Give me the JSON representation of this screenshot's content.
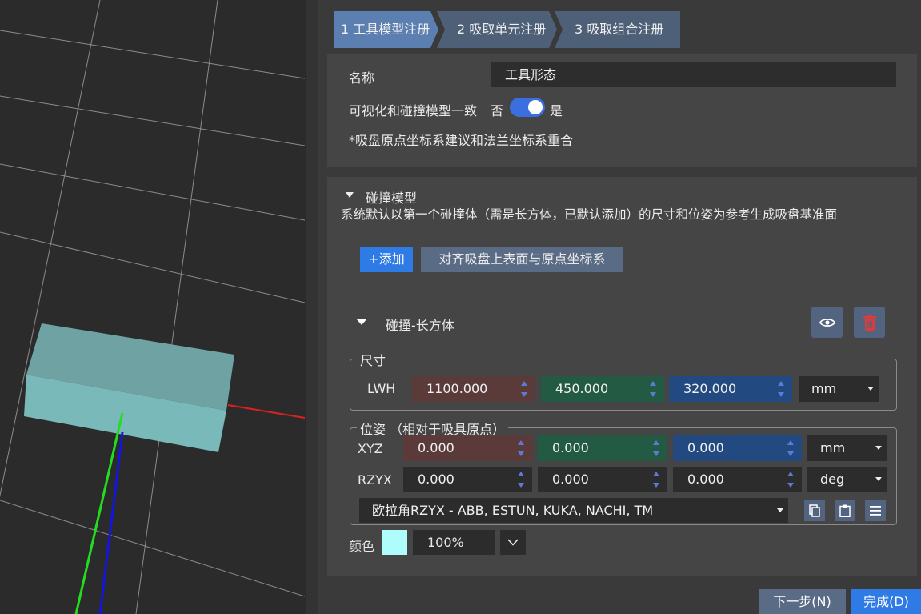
{
  "steps": [
    "1 工具模型注册",
    "2 吸取单元注册",
    "3 吸取组合注册"
  ],
  "basic": {
    "name_label": "名称",
    "name_value": "工具形态",
    "consistency_label": "可视化和碰撞模型一致",
    "toggle_off_label": "否",
    "toggle_on_label": "是",
    "toggle_on": true,
    "hint": "*吸盘原点坐标系建议和法兰坐标系重合"
  },
  "collision": {
    "section_title": "碰撞模型",
    "description": "系统默认以第一个碰撞体（需是长方体，已默认添加）的尺寸和位姿为参考生成吸盘基准面",
    "add_button": "+添加",
    "align_button": "对齐吸盘上表面与原点坐标系",
    "body_title": "碰撞-长方体",
    "size": {
      "legend": "尺寸",
      "row_label": "LWH",
      "values": [
        "1100.000",
        "450.000",
        "320.000"
      ],
      "unit": "mm"
    },
    "pose": {
      "legend": "位姿 （相对于吸具原点）",
      "xyz_label": "XYZ",
      "xyz_values": [
        "0.000",
        "0.000",
        "0.000"
      ],
      "xyz_unit": "mm",
      "rzyx_label": "RZYX",
      "rzyx_values": [
        "0.000",
        "0.000",
        "0.000"
      ],
      "rzyx_unit": "deg",
      "euler_convention": "欧拉角RZYX - ABB, ESTUN, KUKA, NACHI, TM"
    },
    "color": {
      "label": "颜色",
      "swatch": "#aefcfc",
      "opacity": "100%"
    }
  },
  "footer": {
    "next_button": "下一步(N)",
    "finish_button": "完成(D)"
  },
  "colors": {
    "accent": "#2f7be6",
    "step_active": "#5b7fb0",
    "step_inactive": "#4e5f78",
    "delete_red": "#e03a3a"
  }
}
